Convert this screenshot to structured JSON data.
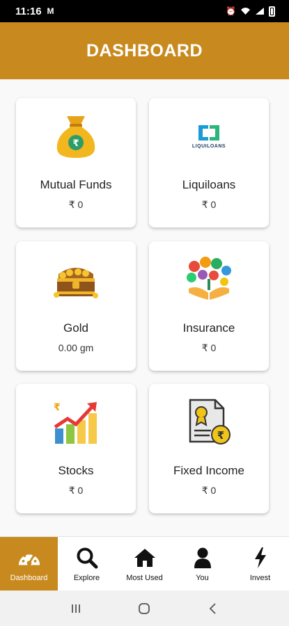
{
  "status_bar": {
    "time": "11:16",
    "mail_glyph": "M"
  },
  "header": {
    "title": "DASHBOARD"
  },
  "cards": [
    {
      "title": "Mutual Funds",
      "value": "₹ 0",
      "icon": "money-bag-icon"
    },
    {
      "title": "Liquiloans",
      "value": "₹ 0",
      "icon": "liquiloans-logo",
      "logo_text": "LIQUILOANS"
    },
    {
      "title": "Gold",
      "value": "0.00 gm",
      "icon": "treasure-chest-icon"
    },
    {
      "title": "Insurance",
      "value": "₹ 0",
      "icon": "insurance-tree-icon"
    },
    {
      "title": "Stocks",
      "value": "₹ 0",
      "icon": "stocks-growth-icon"
    },
    {
      "title": "Fixed Income",
      "value": "₹ 0",
      "icon": "certificate-icon"
    }
  ],
  "bottom_nav": [
    {
      "label": "Dashboard",
      "icon": "speedometer-icon",
      "active": true
    },
    {
      "label": "Explore",
      "icon": "search-icon",
      "active": false
    },
    {
      "label": "Most Used",
      "icon": "home-icon",
      "active": false
    },
    {
      "label": "You",
      "icon": "user-icon",
      "active": false
    },
    {
      "label": "Invest",
      "icon": "lightning-icon",
      "active": false
    }
  ],
  "colors": {
    "accent": "#c88a1f",
    "status_bar": "#000000",
    "card_bg": "#ffffff"
  }
}
